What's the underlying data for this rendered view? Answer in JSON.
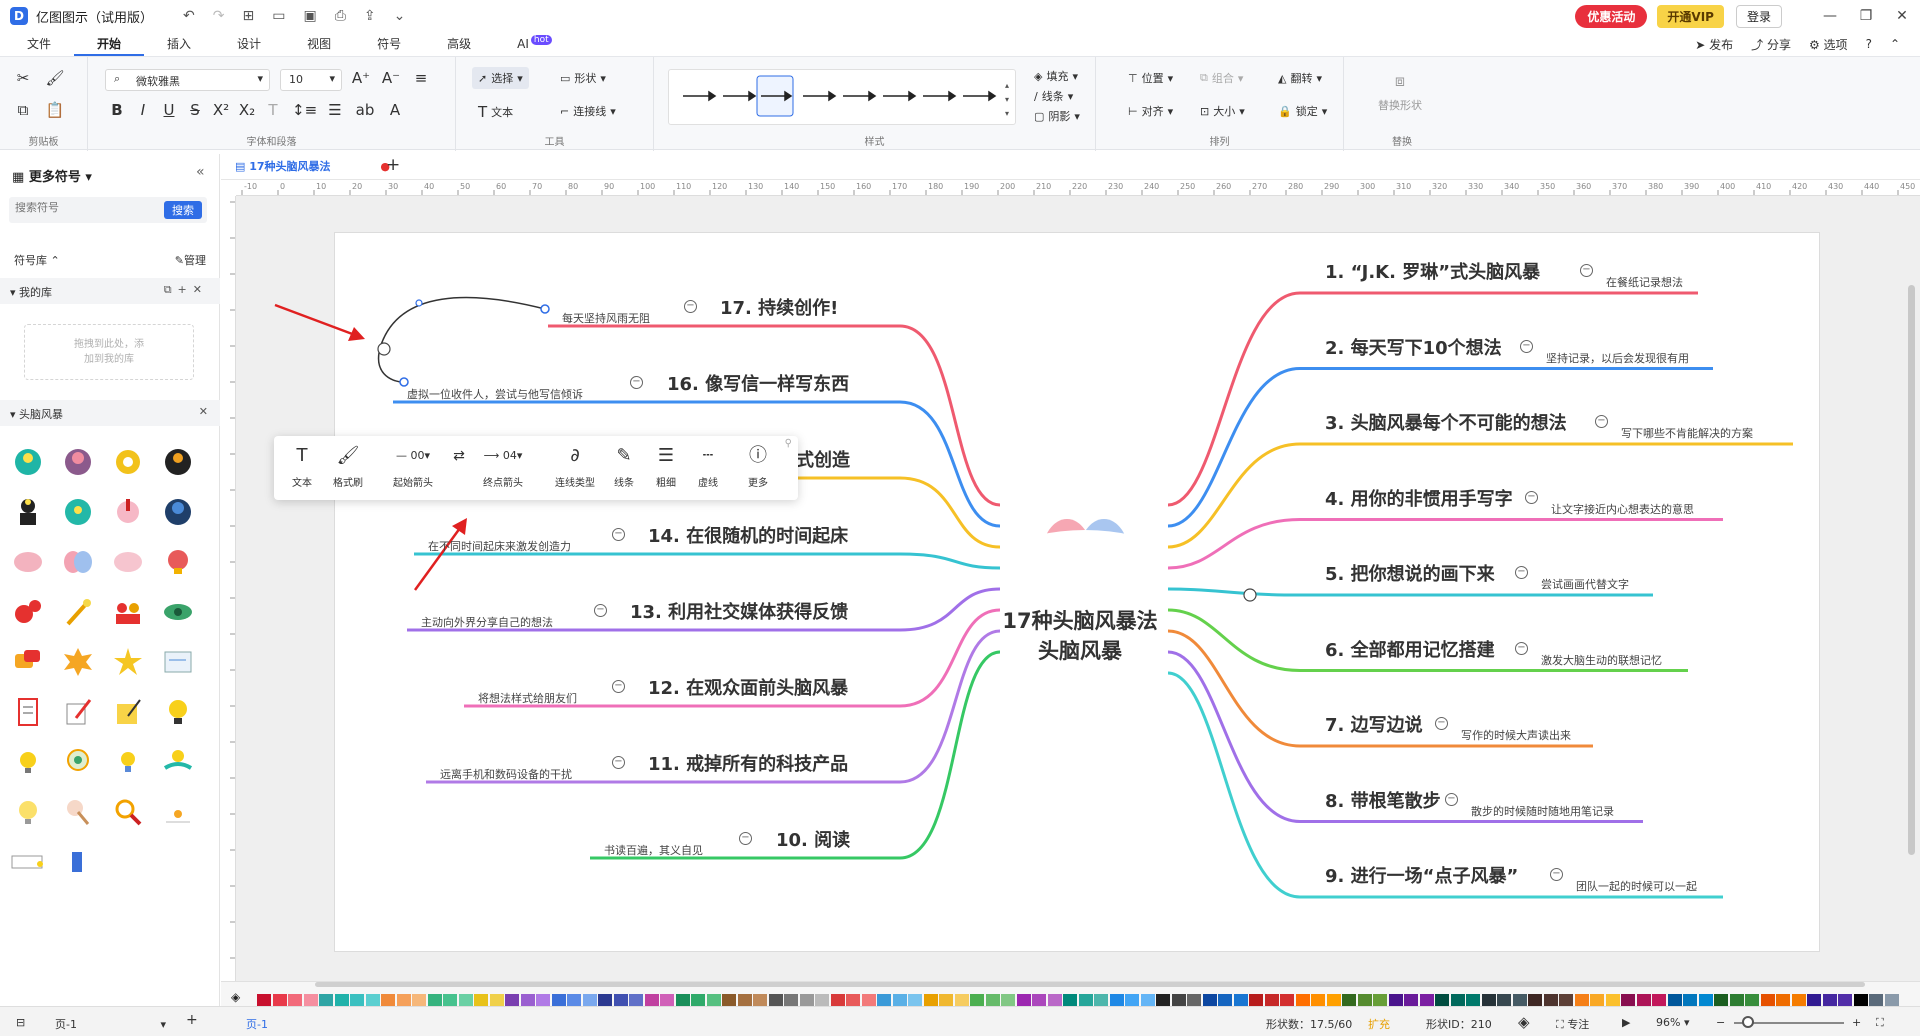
{
  "app": {
    "title": "亿图图示（试用版）",
    "promo_label": "优惠活动",
    "vip_label": "开通VIP",
    "login_label": "登录"
  },
  "menu": {
    "tabs": [
      "文件",
      "开始",
      "插入",
      "设计",
      "视图",
      "符号",
      "高级",
      "AI"
    ],
    "ai_badge": "hot",
    "right": [
      "发布",
      "分享",
      "选项",
      "?"
    ]
  },
  "ribbon": {
    "font_name": "微软雅黑",
    "font_size": "10",
    "select_label": "选择",
    "shape_label": "形状",
    "text_label": "文本",
    "connector_label": "连接线",
    "fill_label": "填充",
    "line_label": "线条",
    "shadow_label": "阴影",
    "position_label": "位置",
    "group_label": "组合",
    "flip_label": "翻转",
    "align_label": "对齐",
    "size_label": "大小",
    "lock_label": "锁定",
    "replace_shape_label": "替换形状",
    "groups": {
      "clipboard": "剪贴板",
      "font": "字体和段落",
      "tools": "工具",
      "styles": "样式",
      "arrange": "排列",
      "replace": "替换"
    }
  },
  "left_panel": {
    "title": "更多符号",
    "search_placeholder": "搜索符号",
    "search_button": "搜索",
    "library_label": "符号库",
    "manage_label": "管理",
    "my_library": "我的库",
    "drop_hint_1": "拖拽到此处，添",
    "drop_hint_2": "加到我的库",
    "category": "头脑风暴"
  },
  "document": {
    "tab_title": "17种头脑风暴法"
  },
  "mindmap": {
    "center_line1": "17种头脑风暴法",
    "center_line2": "头脑风暴",
    "right_nodes": [
      {
        "title": "1. “J.K. 罗琳”式头脑风暴",
        "note": "在餐纸记录想法",
        "color": "#ef5a6f"
      },
      {
        "title": "2. 每天写下10个想法",
        "note": "坚持记录，以后会发现很有用",
        "color": "#3d8ef0"
      },
      {
        "title": "3. 头脑风暴每个不可能的想法",
        "note": "写下哪些不肯能解决的方案",
        "color": "#f6c026"
      },
      {
        "title": "4. 用你的非惯用手写字",
        "note": "让文字接近内心想表达的意思",
        "color": "#ef6fb8"
      },
      {
        "title": "5. 把你想说的画下来",
        "note": "尝试画画代替文字",
        "color": "#36c3d1"
      },
      {
        "title": "6. 全部都用记忆搭建",
        "note": "激发大脑生动的联想记忆",
        "color": "#64d14c"
      },
      {
        "title": "7. 边写边说",
        "note": "写作的时候大声读出来",
        "color": "#f08a3a"
      },
      {
        "title": "8. 带根笔散步",
        "note": "散步的时候随时随地用笔记录",
        "color": "#a070e8"
      },
      {
        "title": "9. 进行一场“点子风暴”",
        "note": "团队一起的时候可以一起",
        "color": "#40cfcf"
      }
    ],
    "left_nodes": [
      {
        "title": "17. 持续创作!",
        "note": "每天坚持风雨无阻",
        "color": "#ef5a6f"
      },
      {
        "title": "16. 像写信一样写东西",
        "note": "虚拟一位收件人，尝试与他写信倾诉",
        "color": "#3d8ef0"
      },
      {
        "title": "式创造",
        "note": "",
        "color": "#f6c026"
      },
      {
        "title": "14. 在很随机的时间起床",
        "note": "在不同时间起床来激发创造力",
        "color": "#36c3d1"
      },
      {
        "title": "13. 利用社交媒体获得反馈",
        "note": "主动向外界分享自己的想法",
        "color": "#a070e8"
      },
      {
        "title": "12. 在观众面前头脑风暴",
        "note": "将想法样式给朋友们",
        "color": "#ef6fb8"
      },
      {
        "title": "11. 戒掉所有的科技产品",
        "note": "远离手机和数码设备的干扰",
        "color": "#b07ae6"
      },
      {
        "title": "10. 阅读",
        "note": "书读百遍，其义自见",
        "color": "#36c864"
      }
    ]
  },
  "float_toolbar": {
    "text": "文本",
    "format_painter": "格式刷",
    "start_arrow": "起始箭头",
    "start_value": "00",
    "end_arrow": "终点箭头",
    "end_value": "04",
    "connector_type": "连线类型",
    "line": "线条",
    "thickness": "粗细",
    "dashed": "虚线",
    "more": "更多"
  },
  "status": {
    "page_selector": "页-1",
    "page_tab": "页-1",
    "shape_count": "形状数：17.5/60",
    "expand": "扩充",
    "shape_id": "形状ID：210",
    "focus": "专注",
    "zoom": "96%"
  },
  "colors": {
    "accent": "#2f6de6",
    "canvas_bg": "#efefef",
    "arrow_red": "#e02020"
  }
}
